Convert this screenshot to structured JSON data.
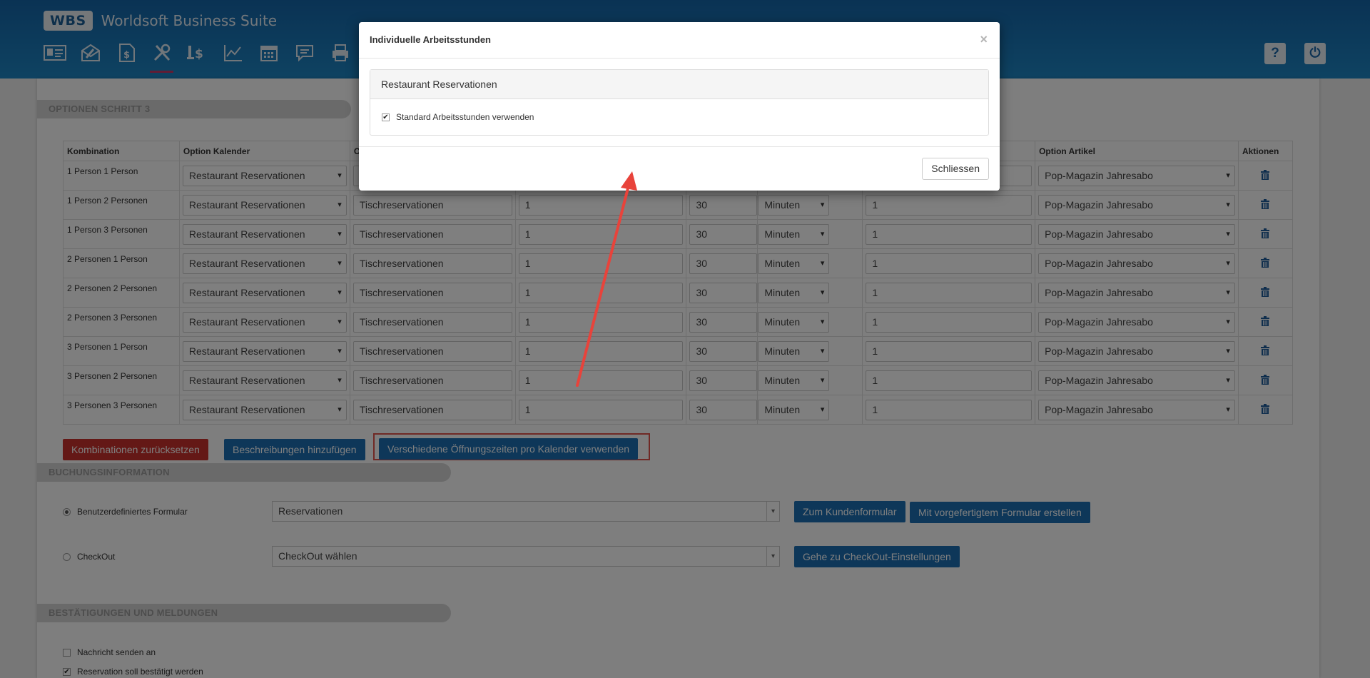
{
  "app": {
    "logo_badge": "WBS",
    "title": "Worldsoft Business Suite"
  },
  "nav_icons": [
    "contact-card-icon",
    "mail-icon",
    "finance-icon",
    "tools-icon",
    "pricing-icon",
    "chart-icon",
    "calendar-icon",
    "chat-icon",
    "print-icon"
  ],
  "header_right": {
    "help": "?",
    "power": "⏻"
  },
  "sections": {
    "options_step3": "OPTIONEN SCHRITT 3",
    "booking_info": "BUCHUNGSINFORMATION",
    "confirmations": "BESTÄTIGUNGEN UND MELDUNGEN"
  },
  "table": {
    "headers": [
      "Kombination",
      "Option Kalender",
      "O",
      "",
      "",
      "",
      "",
      "Option Artikel",
      "Aktionen"
    ],
    "rows": [
      {
        "comb": "1 Person 1 Person",
        "calendar": "Restaurant Reservationen",
        "resource": "",
        "qty": "",
        "duration": "",
        "unit": "",
        "count": "",
        "article": "Pop-Magazin Jahresabo"
      },
      {
        "comb": "1 Person 2 Personen",
        "calendar": "Restaurant Reservationen",
        "resource": "Tischreservationen",
        "qty": "1",
        "duration": "30",
        "unit": "Minuten",
        "count": "1",
        "article": "Pop-Magazin Jahresabo"
      },
      {
        "comb": "1 Person 3 Personen",
        "calendar": "Restaurant Reservationen",
        "resource": "Tischreservationen",
        "qty": "1",
        "duration": "30",
        "unit": "Minuten",
        "count": "1",
        "article": "Pop-Magazin Jahresabo"
      },
      {
        "comb": "2 Personen 1 Person",
        "calendar": "Restaurant Reservationen",
        "resource": "Tischreservationen",
        "qty": "1",
        "duration": "30",
        "unit": "Minuten",
        "count": "1",
        "article": "Pop-Magazin Jahresabo"
      },
      {
        "comb": "2 Personen 2 Personen",
        "calendar": "Restaurant Reservationen",
        "resource": "Tischreservationen",
        "qty": "1",
        "duration": "30",
        "unit": "Minuten",
        "count": "1",
        "article": "Pop-Magazin Jahresabo"
      },
      {
        "comb": "2 Personen 3 Personen",
        "calendar": "Restaurant Reservationen",
        "resource": "Tischreservationen",
        "qty": "1",
        "duration": "30",
        "unit": "Minuten",
        "count": "1",
        "article": "Pop-Magazin Jahresabo"
      },
      {
        "comb": "3 Personen 1 Person",
        "calendar": "Restaurant Reservationen",
        "resource": "Tischreservationen",
        "qty": "1",
        "duration": "30",
        "unit": "Minuten",
        "count": "1",
        "article": "Pop-Magazin Jahresabo"
      },
      {
        "comb": "3 Personen 2 Personen",
        "calendar": "Restaurant Reservationen",
        "resource": "Tischreservationen",
        "qty": "1",
        "duration": "30",
        "unit": "Minuten",
        "count": "1",
        "article": "Pop-Magazin Jahresabo"
      },
      {
        "comb": "3 Personen 3 Personen",
        "calendar": "Restaurant Reservationen",
        "resource": "Tischreservationen",
        "qty": "1",
        "duration": "30",
        "unit": "Minuten",
        "count": "1",
        "article": "Pop-Magazin Jahresabo"
      }
    ]
  },
  "buttons": {
    "reset": "Kombinationen zurücksetzen",
    "add_desc": "Beschreibungen hinzufügen",
    "diff_hours": "Verschiedene Öffnungszeiten pro Kalender verwenden",
    "to_form": "Zum Kundenformular",
    "create_form": "Mit vorgefertigtem Formular erstellen",
    "checkout_settings": "Gehe zu CheckOut-Einstellungen"
  },
  "booking": {
    "custom_form_label": "Benutzerdefiniertes Formular",
    "custom_form_value": "Reservationen",
    "checkout_label": "CheckOut",
    "checkout_value": "CheckOut wählen"
  },
  "confirmations": {
    "send_message": "Nachricht senden an",
    "must_confirm": "Reservation soll bestätigt werden"
  },
  "modal": {
    "title": "Individuelle Arbeitsstunden",
    "close": "×",
    "panel_title": "Restaurant Reservationen",
    "checkbox_label": "Standard Arbeitsstunden verwenden",
    "close_button": "Schliessen"
  },
  "colors": {
    "header": "#1a73b8",
    "primary": "#1c6eb2",
    "danger": "#c9302c",
    "arrow": "#e8433b"
  }
}
